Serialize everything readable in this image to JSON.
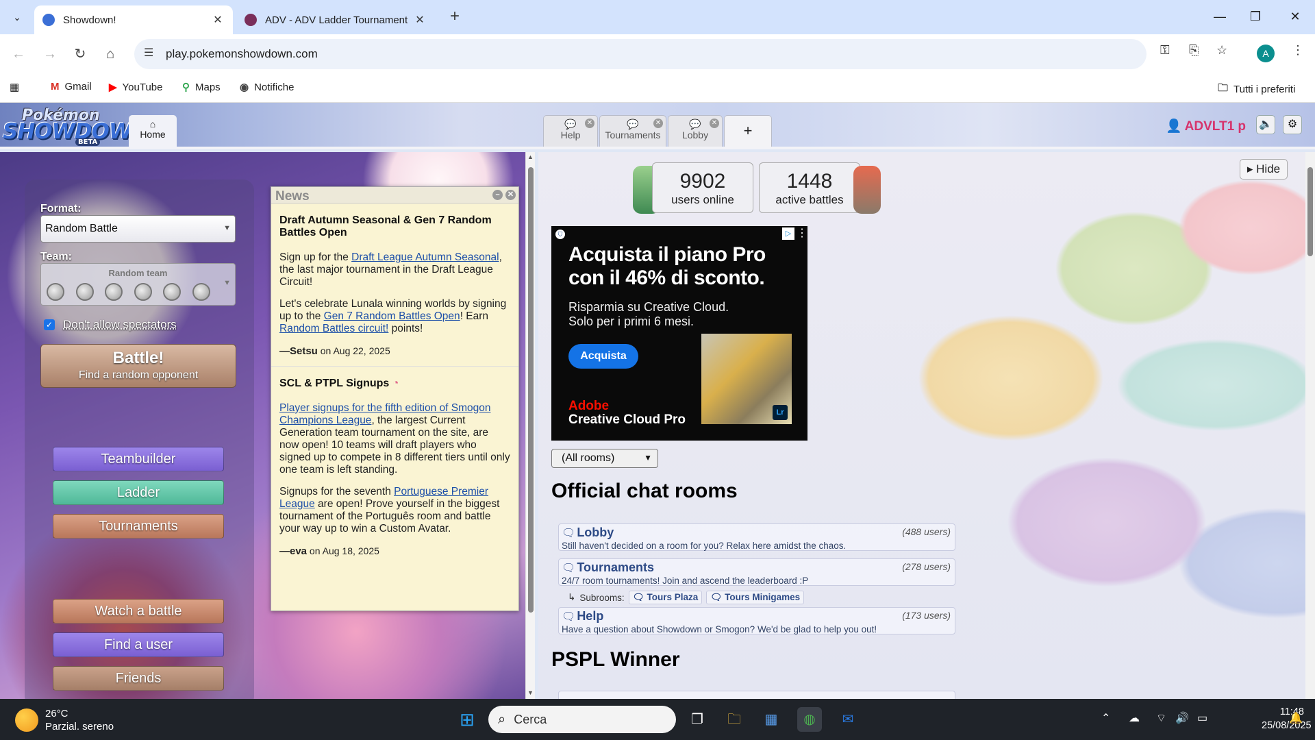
{
  "browser": {
    "tabs": [
      {
        "title": "Showdown!",
        "active": true
      },
      {
        "title": "ADV - ADV Ladder Tournament",
        "active": false
      }
    ],
    "url": "play.pokemonshowdown.com",
    "bookmarks": [
      "Gmail",
      "YouTube",
      "Maps",
      "Notifiche"
    ],
    "all_bookmarks": "Tutti i preferiti",
    "profile_initial": "A"
  },
  "header": {
    "logo_line1": "Pokémon",
    "logo_line2": "SHOWDOWN",
    "logo_badge": "BETA",
    "home_label": "Home",
    "room_tabs": [
      "Help",
      "Tournaments",
      "Lobby"
    ],
    "add_tab": "+",
    "username": "ADVLT1 p"
  },
  "left": {
    "format_label": "Format:",
    "format_value": "Random Battle",
    "team_label": "Team:",
    "team_value": "Random team",
    "no_spectators": "Don't allow spectators",
    "battle_title": "Battle!",
    "battle_sub": "Find a random opponent",
    "menu": [
      {
        "label": "Teambuilder",
        "color": "#8a6ee0"
      },
      {
        "label": "Ladder",
        "color": "#63c6a8"
      },
      {
        "label": "Tournaments",
        "color": "#c98a6c"
      },
      {
        "label": "Watch a battle",
        "color": "#c98a6c"
      },
      {
        "label": "Find a user",
        "color": "#8a6ee0"
      },
      {
        "label": "Friends",
        "color": "#b89077"
      }
    ]
  },
  "news": {
    "title": "News",
    "articles": [
      {
        "title": "Draft Autumn Seasonal & Gen 7 Random Battles Open",
        "p1_pre": "Sign up for the ",
        "p1_link": "Draft League Autumn Seasonal",
        "p1_post": ", the last major tournament in the Draft League Circuit!",
        "p2_pre": "Let's celebrate Lunala winning worlds by signing up to the ",
        "p2_link1": "Gen 7 Random Battles Open",
        "p2_mid": "! Earn ",
        "p2_link2": "Random Battles circuit!",
        "p2_post": " points!",
        "author": "—Setsu",
        "date": "on Aug 22, 2025"
      },
      {
        "title": "SCL & PTPL Signups",
        "p1_link": "Player signups for the fifth edition of Smogon Champions League",
        "p1_post": ", the largest Current Generation team tournament on the site, are now open! 10 teams will draft players who signed up to compete in 8 different tiers until only one team is left standing.",
        "p2_pre": "Signups for the seventh ",
        "p2_link": "Portuguese Premier League",
        "p2_post": " are open! Prove yourself in the biggest tournament of the Português room and battle your way up to win a Custom Avatar.",
        "author": "—eva",
        "date": "on Aug 18, 2025"
      }
    ]
  },
  "right": {
    "hide_label": "Hide",
    "users_online": "9902",
    "users_online_label": "users online",
    "active_battles": "1448",
    "active_battles_label": "active battles",
    "ad": {
      "headline": "Acquista il piano Pro con il 46% di sconto.",
      "sub": "Risparmia su Creative Cloud. Solo per i primi 6 mesi.",
      "cta": "Acquista",
      "brand_line1": "Adobe",
      "brand_line2": "Creative Cloud Pro",
      "photo_badge": "Lr"
    },
    "rooms_filter": "(All rooms)",
    "official_title": "Official chat rooms",
    "rooms": [
      {
        "name": "Lobby",
        "users": "(488 users)",
        "desc": "Still haven't decided on a room for you? Relax here amidst the chaos."
      },
      {
        "name": "Tournaments",
        "users": "(278 users)",
        "desc": "24/7 room tournaments! Join and ascend the leaderboard :P"
      },
      {
        "name": "Help",
        "users": "(173 users)",
        "desc": "Have a question about Showdown or Smogon? We'd be glad to help you out!"
      }
    ],
    "subrooms_label": "Subrooms:",
    "subrooms": [
      "Tours Plaza",
      "Tours Minigames"
    ],
    "pspl_title": "PSPL Winner"
  },
  "taskbar": {
    "temperature": "26°C",
    "weather": "Parzial. sereno",
    "search_placeholder": "Cerca",
    "time": "11:48",
    "date": "25/08/2025"
  }
}
